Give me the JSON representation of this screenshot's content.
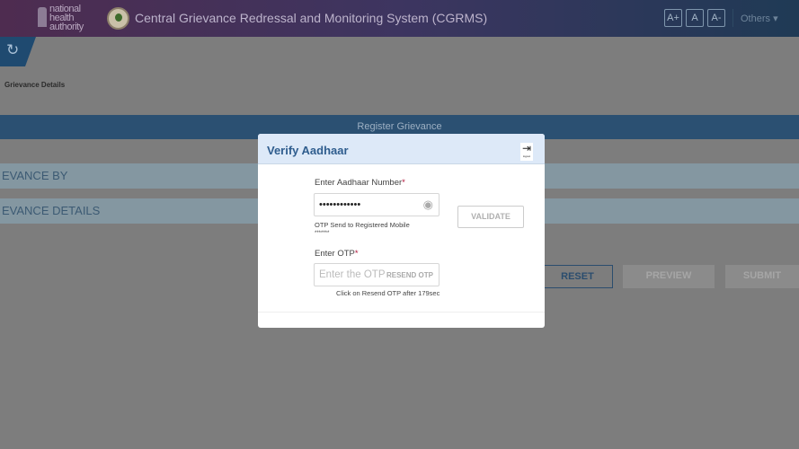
{
  "header": {
    "logo_lines": [
      "national",
      "health",
      "authority"
    ],
    "title": "Central Grievance Redressal and Monitoring System (CGRMS)",
    "font_buttons": [
      "A+",
      "A",
      "A-"
    ],
    "others_label": "Others ▾"
  },
  "page": {
    "refresh_icon": "refresh-icon",
    "section_label": "Grievance Details",
    "register_bar": "Register Grievance",
    "sections": [
      "EVANCE BY",
      "EVANCE DETAILS"
    ],
    "buttons": {
      "reset": "RESET",
      "preview": "PREVIEW",
      "submit": "SUBMIT"
    }
  },
  "modal": {
    "title": "Verify Aadhaar",
    "logout_label": "logout",
    "aadhaar_label": "Enter Aadhaar Number",
    "required": "*",
    "aadhaar_value": "••••••••••••",
    "otp_sent": "OTP Send to Registered Mobile",
    "masked_mobile": "*******",
    "validate": "VALIDATE",
    "otp_label": "Enter OTP",
    "otp_placeholder": "Enter the OTP",
    "resend": "RESEND OTP",
    "resend_hint": "Click on Resend OTP after 179sec"
  }
}
